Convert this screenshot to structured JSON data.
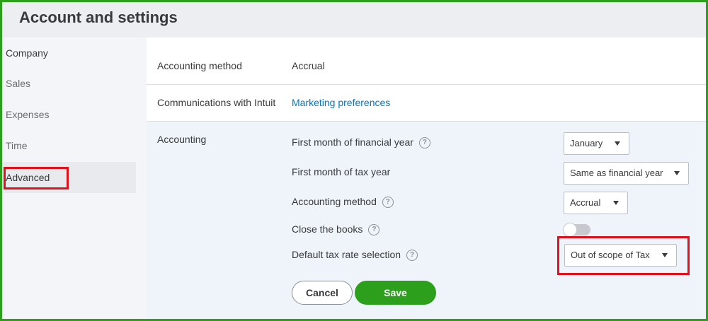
{
  "page": {
    "title": "Account and settings"
  },
  "sidebar": {
    "items": [
      {
        "label": "Company"
      },
      {
        "label": "Sales"
      },
      {
        "label": "Expenses"
      },
      {
        "label": "Time"
      },
      {
        "label": "Advanced"
      }
    ],
    "active": "Advanced"
  },
  "rows": {
    "accounting_method": {
      "label": "Accounting method",
      "value": "Accrual"
    },
    "communications": {
      "label": "Communications with Intuit",
      "link": "Marketing preferences"
    }
  },
  "accounting": {
    "section_label": "Accounting",
    "first_month_financial": {
      "label": "First month of financial year",
      "value": "January"
    },
    "first_month_tax": {
      "label": "First month of tax year",
      "value": "Same as financial year"
    },
    "method": {
      "label": "Accounting method",
      "value": "Accrual"
    },
    "close_books": {
      "label": "Close the books",
      "enabled": false
    },
    "default_tax": {
      "label": "Default tax rate selection",
      "value": "Out of scope of Tax"
    },
    "help_glyph": "?"
  },
  "buttons": {
    "cancel": "Cancel",
    "save": "Save"
  },
  "colors": {
    "accent": "#2ca01c",
    "link": "#0077c5",
    "highlight": "#e0101c"
  }
}
